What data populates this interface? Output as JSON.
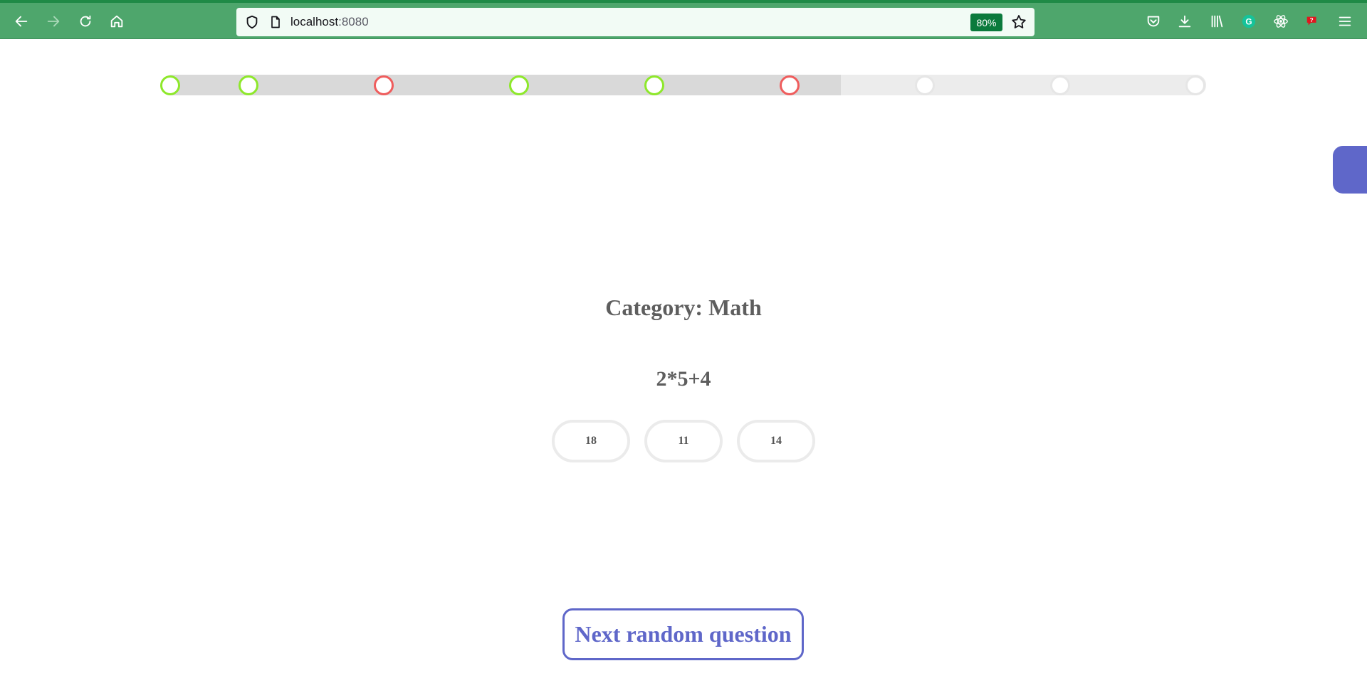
{
  "browser": {
    "url_host": "localhost",
    "url_port": ":8080",
    "zoom": "80%",
    "colors": {
      "toolbar": "#4ea66c",
      "zoom_badge": "#0b7a3c"
    },
    "icons": [
      "back-icon",
      "forward-icon",
      "reload-icon",
      "home-icon",
      "shield-icon",
      "page-icon",
      "star-icon",
      "pocket-icon",
      "download-icon",
      "library-icon",
      "grammarly-icon",
      "react-devtools-icon",
      "extension-icon",
      "menu-icon"
    ]
  },
  "progress": {
    "completed_fraction": 0.65,
    "states": [
      "correct",
      "correct",
      "wrong",
      "correct",
      "correct",
      "wrong",
      "pending",
      "pending",
      "pending"
    ],
    "colors": {
      "correct": "#8ee82b",
      "wrong": "#ef5d5d",
      "pending": "#e6e6e6"
    }
  },
  "quiz": {
    "category_label": "Category: Math",
    "question": "2*5+4",
    "answers": [
      "18",
      "11",
      "14"
    ],
    "next_label": "Next random question",
    "accent_color": "#5f67c9"
  }
}
